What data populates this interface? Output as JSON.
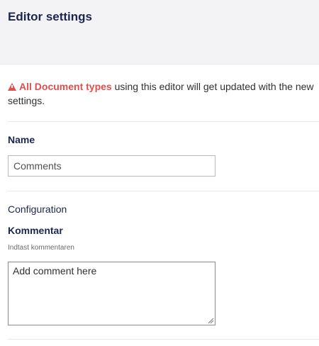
{
  "header": {
    "title": "Editor settings"
  },
  "notice": {
    "warning_text": "All Document types",
    "rest_text": " using this editor will get updated with the new settings."
  },
  "name_section": {
    "label": "Name",
    "value": "Comments"
  },
  "configuration": {
    "heading": "Configuration",
    "field_label": "Kommentar",
    "field_description": "Indtast kommentaren",
    "field_value": "Add comment here"
  },
  "colors": {
    "warning": "#e24e4c",
    "header_bg": "#f3f3f5",
    "text_dark": "#1b264f"
  },
  "icons": {
    "warning": "warning-icon"
  }
}
